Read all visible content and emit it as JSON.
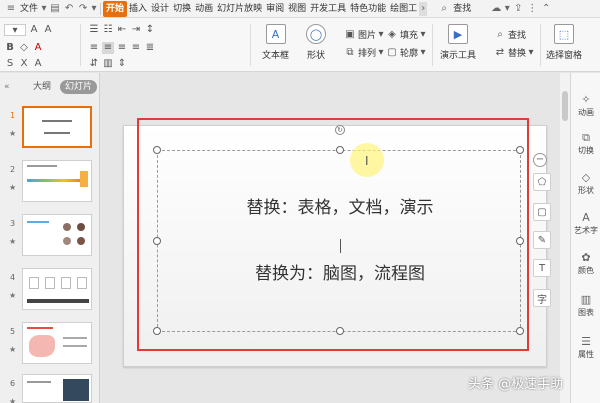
{
  "menubar": {
    "file": "文件",
    "items": [
      "开始",
      "插入",
      "设计",
      "切换",
      "动画",
      "幻灯片放映",
      "审阅",
      "视图",
      "开发工具",
      "特色功能",
      "绘图工"
    ],
    "active_index": 0,
    "search": "查找"
  },
  "ribbon": {
    "textbox": "文本框",
    "shape": "形状",
    "image": "图片",
    "fill": "填充",
    "arrange": "排列",
    "outline": "轮廓",
    "presenter_tools": "演示工具",
    "find": "查找",
    "replace": "替换",
    "select_pane": "选择窗格"
  },
  "left_panel": {
    "tab_outline": "大纲",
    "tab_slides": "幻灯片",
    "slide_numbers": [
      "1",
      "2",
      "3",
      "4",
      "5",
      "6"
    ],
    "selected_index": 0
  },
  "slide": {
    "line1": "替换：表格，文档，演示",
    "line2": "替换为：脑图，流程图"
  },
  "right_panel": {
    "items": [
      "动画",
      "切换",
      "形状",
      "艺术字",
      "颜色",
      "图表",
      "属性"
    ]
  },
  "watermark": "头条 @极速手助",
  "colors": {
    "accent": "#e8700c",
    "highlight_box": "#e53935"
  }
}
